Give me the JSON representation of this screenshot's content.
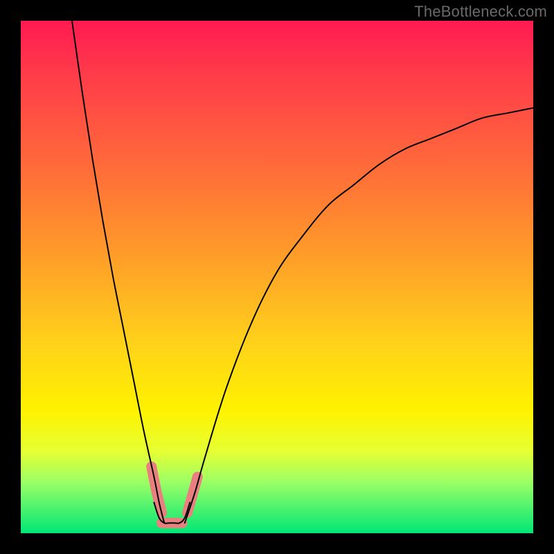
{
  "watermark": "TheBottleneck.com",
  "chart_data": {
    "type": "line",
    "title": "",
    "xlabel": "",
    "ylabel": "",
    "xlim": [
      0,
      100
    ],
    "ylim": [
      0,
      100
    ],
    "grid": false,
    "legend": false,
    "series": [
      {
        "name": "left-branch",
        "x": [
          10,
          12,
          14,
          16,
          18,
          20,
          22,
          24,
          26,
          27,
          28
        ],
        "values": [
          100,
          86,
          73,
          61,
          50,
          40,
          30,
          20,
          11,
          6,
          2
        ]
      },
      {
        "name": "right-branch",
        "x": [
          32,
          34,
          36,
          40,
          45,
          50,
          55,
          60,
          65,
          70,
          75,
          80,
          85,
          90,
          95,
          100
        ],
        "values": [
          2,
          8,
          15,
          28,
          41,
          51,
          58,
          64,
          68,
          72,
          75,
          77,
          79,
          81,
          82,
          83
        ]
      },
      {
        "name": "valley-floor",
        "x": [
          26,
          27,
          28,
          29,
          30,
          31,
          32,
          33
        ],
        "values": [
          6,
          3,
          2,
          2,
          2,
          2,
          3,
          6
        ]
      }
    ],
    "highlight_segments": [
      {
        "name": "left-marker-1",
        "x": [
          25.5,
          26.5
        ],
        "y": [
          13,
          8
        ]
      },
      {
        "name": "left-marker-2",
        "x": [
          26.5,
          27.5
        ],
        "y": [
          8,
          4
        ]
      },
      {
        "name": "floor-marker",
        "x": [
          27.5,
          31.5
        ],
        "y": [
          2,
          2
        ]
      },
      {
        "name": "right-marker-1",
        "x": [
          32.5,
          34.5
        ],
        "y": [
          4,
          11
        ]
      }
    ],
    "colors": {
      "curve": "#000000",
      "highlight": "#e98080"
    }
  }
}
